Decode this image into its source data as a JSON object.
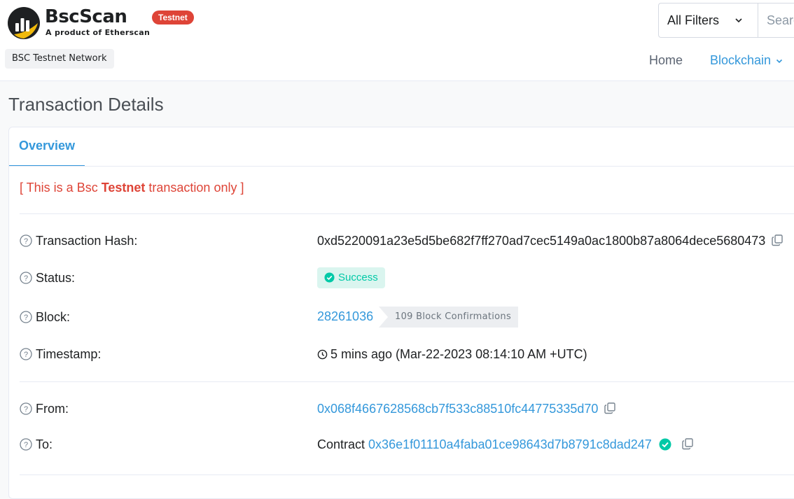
{
  "header": {
    "brand": "BscScan",
    "tagline": "A product of Etherscan",
    "env_badge": "Testnet",
    "network": "BSC Testnet Network",
    "filter": {
      "selected": "All Filters"
    },
    "search_placeholder": "Search by Address / Txn Hash / Block / Token",
    "nav": {
      "home": "Home",
      "blockchain": "Blockchain"
    }
  },
  "page": {
    "title": "Transaction Details",
    "tabs": [
      {
        "label": "Overview"
      }
    ],
    "notice": {
      "pre": "[ This is a Bsc ",
      "bold": "Testnet",
      "post": " transaction only ]"
    }
  },
  "details": {
    "tx_hash": {
      "label": "Transaction Hash:",
      "value": "0xd5220091a23e5d5be682f7ff270ad7cec5149a0ac1800b87a8064dece5680473"
    },
    "status": {
      "label": "Status:",
      "value": "Success"
    },
    "block": {
      "label": "Block:",
      "value": "28261036",
      "confirmations": "109 Block Confirmations"
    },
    "timestamp": {
      "label": "Timestamp:",
      "value": "5 mins ago (Mar-22-2023 08:14:10 AM +UTC)"
    },
    "from": {
      "label": "From:",
      "value": "0x068f4667628568cb7f533c88510fc44775335d70"
    },
    "to": {
      "label": "To:",
      "prefix": "Contract",
      "value": "0x36e1f01110a4faba01ce98643d7b8791c8dad247"
    }
  },
  "colors": {
    "accent": "#3498db",
    "danger": "#de4437",
    "success": "#00c9a7",
    "logo_yellow": "#f0b90b"
  }
}
